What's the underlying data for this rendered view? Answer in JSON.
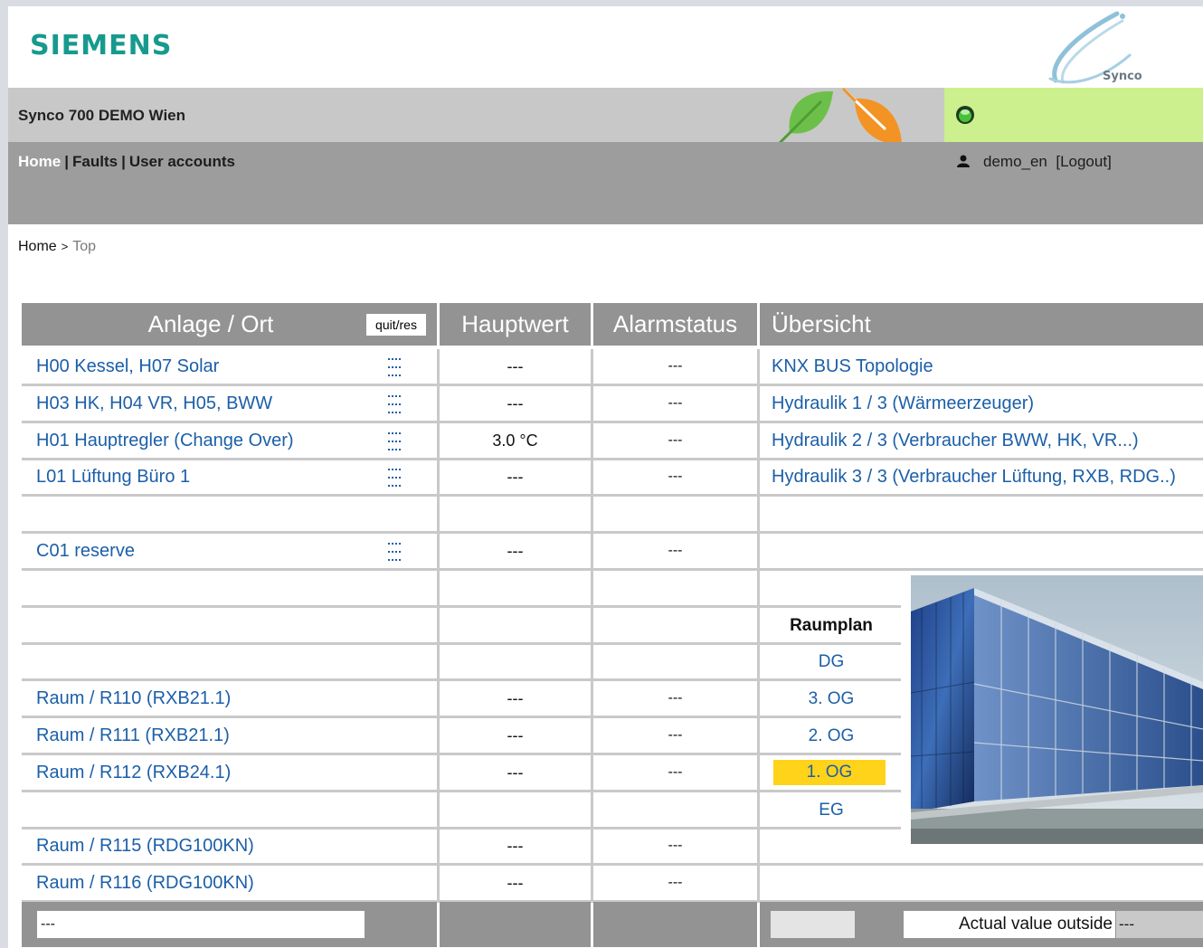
{
  "header": {
    "brand": "SIEMENS",
    "product_logo": "Synco",
    "site_title": "Synco 700 DEMO Wien"
  },
  "icons": {
    "eco_leaf_green": "leaf-icon",
    "eco_leaf_orange": "leaf-icon",
    "status_led": "status-led-icon",
    "user": "user-icon"
  },
  "colors": {
    "brand": "#179a8e",
    "status_bg": "#ccf08e",
    "link": "#1b5fa8",
    "selected_floor": "#ffd31a",
    "leaf_green": "#6cc04a",
    "leaf_orange": "#f39323"
  },
  "nav": {
    "home": "Home",
    "faults": "Faults",
    "user_accounts": "User accounts",
    "separator": "|"
  },
  "user": {
    "name": "demo_en",
    "logout": "[Logout]"
  },
  "breadcrumb": {
    "home": "Home",
    "sep": ">",
    "current": "Top"
  },
  "table": {
    "headers": {
      "anlage": "Anlage / Ort",
      "quit_button": "quit/res",
      "hauptwert": "Hauptwert",
      "alarmstatus": "Alarmstatus",
      "uebersicht": "Übersicht"
    },
    "rows": [
      {
        "name": "H00 Kessel, H07 Solar",
        "value": "---",
        "alarm": "---",
        "overview": "KNX BUS Topologie"
      },
      {
        "name": "H03 HK, H04 VR, H05, BWW",
        "value": "---",
        "alarm": "---",
        "overview": "Hydraulik 1 / 3 (Wärmeerzeuger)"
      },
      {
        "name": "H01 Hauptregler (Change Over)",
        "value": "3.0 °C",
        "alarm": "---",
        "overview": "Hydraulik 2 / 3 (Verbraucher BWW, HK, VR...)"
      },
      {
        "name": "L01 Lüftung Büro 1",
        "value": "---",
        "alarm": "---",
        "overview": "Hydraulik 3 / 3 (Verbraucher Lüftung, RXB, RDG..)"
      },
      {
        "name": "",
        "value": "",
        "alarm": "",
        "overview": ""
      },
      {
        "name": "C01 reserve",
        "value": "---",
        "alarm": "---",
        "overview": ""
      },
      {
        "name": "",
        "value": "",
        "alarm": "",
        "overview": ""
      },
      {
        "name": "",
        "value": "",
        "alarm": "",
        "overview": ""
      },
      {
        "name": "",
        "value": "",
        "alarm": "",
        "overview": ""
      },
      {
        "name": "Raum / R110 (RXB21.1)",
        "value": "---",
        "alarm": "---",
        "overview": ""
      },
      {
        "name": "Raum / R111 (RXB21.1)",
        "value": "---",
        "alarm": "---",
        "overview": ""
      },
      {
        "name": "Raum / R112 (RXB24.1)",
        "value": "---",
        "alarm": "---",
        "overview": ""
      },
      {
        "name": "",
        "value": "",
        "alarm": "",
        "overview": ""
      },
      {
        "name": "Raum / R115 (RDG100KN)",
        "value": "---",
        "alarm": "---",
        "overview": ""
      },
      {
        "name": "Raum / R116 (RDG100KN)",
        "value": "---",
        "alarm": "---",
        "overview": ""
      }
    ],
    "raumplan": {
      "title": "Raumplan",
      "floors": [
        "DG",
        "3. OG",
        "2. OG",
        "1. OG",
        "EG"
      ],
      "selected": "1. OG"
    },
    "footer": {
      "input_value": "---",
      "outside_label": "Actual value outside",
      "outside_value": "---"
    }
  }
}
